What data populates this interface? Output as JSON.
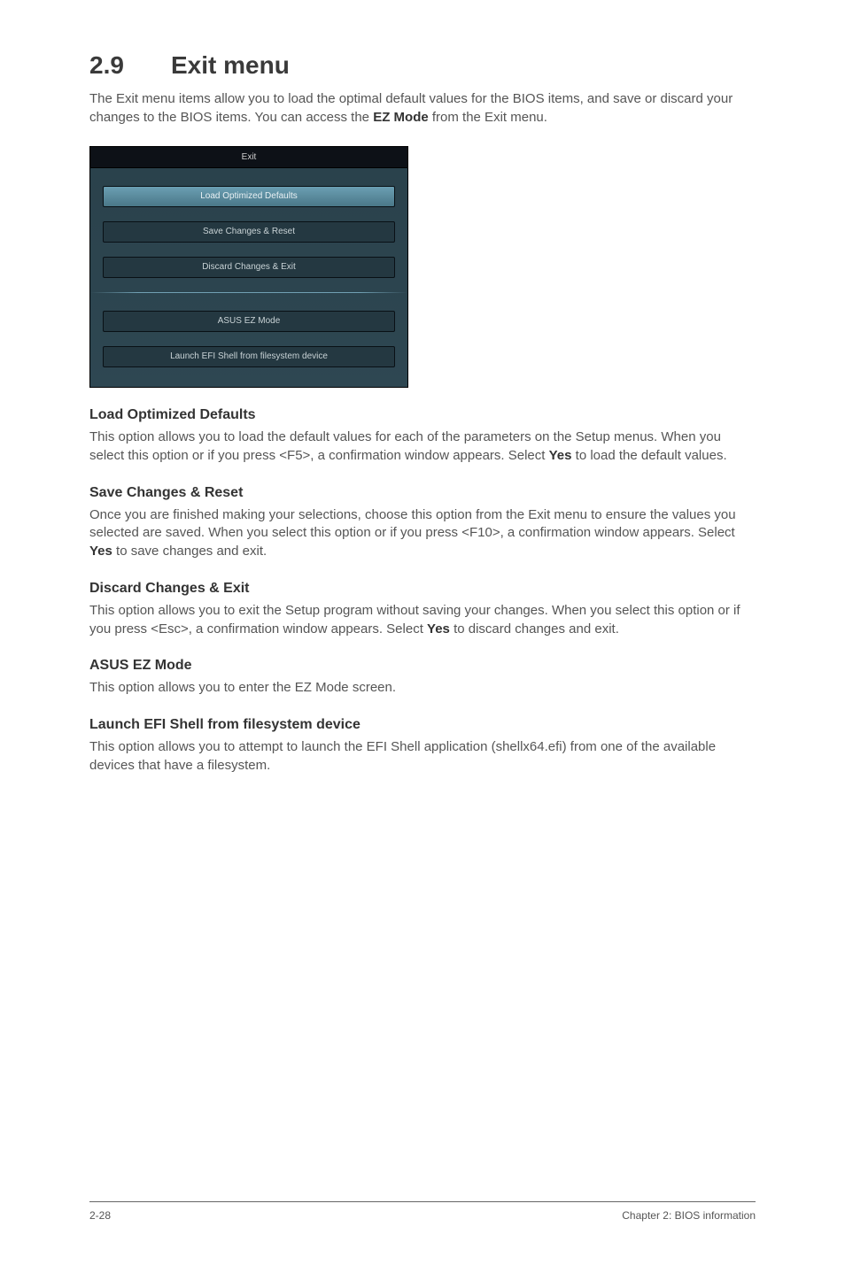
{
  "page": {
    "section_number": "2.9",
    "section_title": "Exit menu",
    "intro_pre": "The Exit menu items allow you to load the optimal default values for the BIOS items, and save or discard your changes to the BIOS items. You can access the ",
    "intro_bold": "EZ Mode",
    "intro_post": " from the Exit menu."
  },
  "bios": {
    "title": "Exit",
    "buttons": [
      {
        "label": "Load Optimized Defaults",
        "highlight": true
      },
      {
        "label": "Save Changes & Reset",
        "highlight": false
      },
      {
        "label": "Discard Changes & Exit",
        "highlight": false
      }
    ],
    "buttons2": [
      {
        "label": "ASUS EZ Mode",
        "highlight": false
      },
      {
        "label": "Launch EFI Shell from filesystem device",
        "highlight": false
      }
    ]
  },
  "sections": {
    "s1": {
      "h": "Load Optimized Defaults",
      "p_pre": "This option allows you to load the default values for each of the parameters on the Setup menus. When you select this option or if you press <F5>, a confirmation window appears. Select ",
      "p_bold": "Yes",
      "p_post": " to load the default values."
    },
    "s2": {
      "h": "Save Changes & Reset",
      "p_pre": "Once you are finished making your selections, choose this option from the Exit menu to ensure the values you selected are saved. When you select this option or if you press <F10>, a confirmation window appears. Select ",
      "p_bold": "Yes",
      "p_post": " to save changes and exit."
    },
    "s3": {
      "h": "Discard Changes & Exit",
      "p_pre": "This option allows you to exit the Setup program without saving your changes. When you select this option or if you press <Esc>, a confirmation window appears. Select ",
      "p_bold": "Yes",
      "p_post": " to discard changes and exit."
    },
    "s4": {
      "h": "ASUS EZ Mode",
      "p": "This option allows you to enter the EZ Mode screen."
    },
    "s5": {
      "h": "Launch EFI Shell from filesystem device",
      "p": "This option allows you to attempt to launch the EFI Shell application (shellx64.efi) from one of the available devices that have a filesystem."
    }
  },
  "footer": {
    "left": "2-28",
    "right": "Chapter 2: BIOS information"
  }
}
